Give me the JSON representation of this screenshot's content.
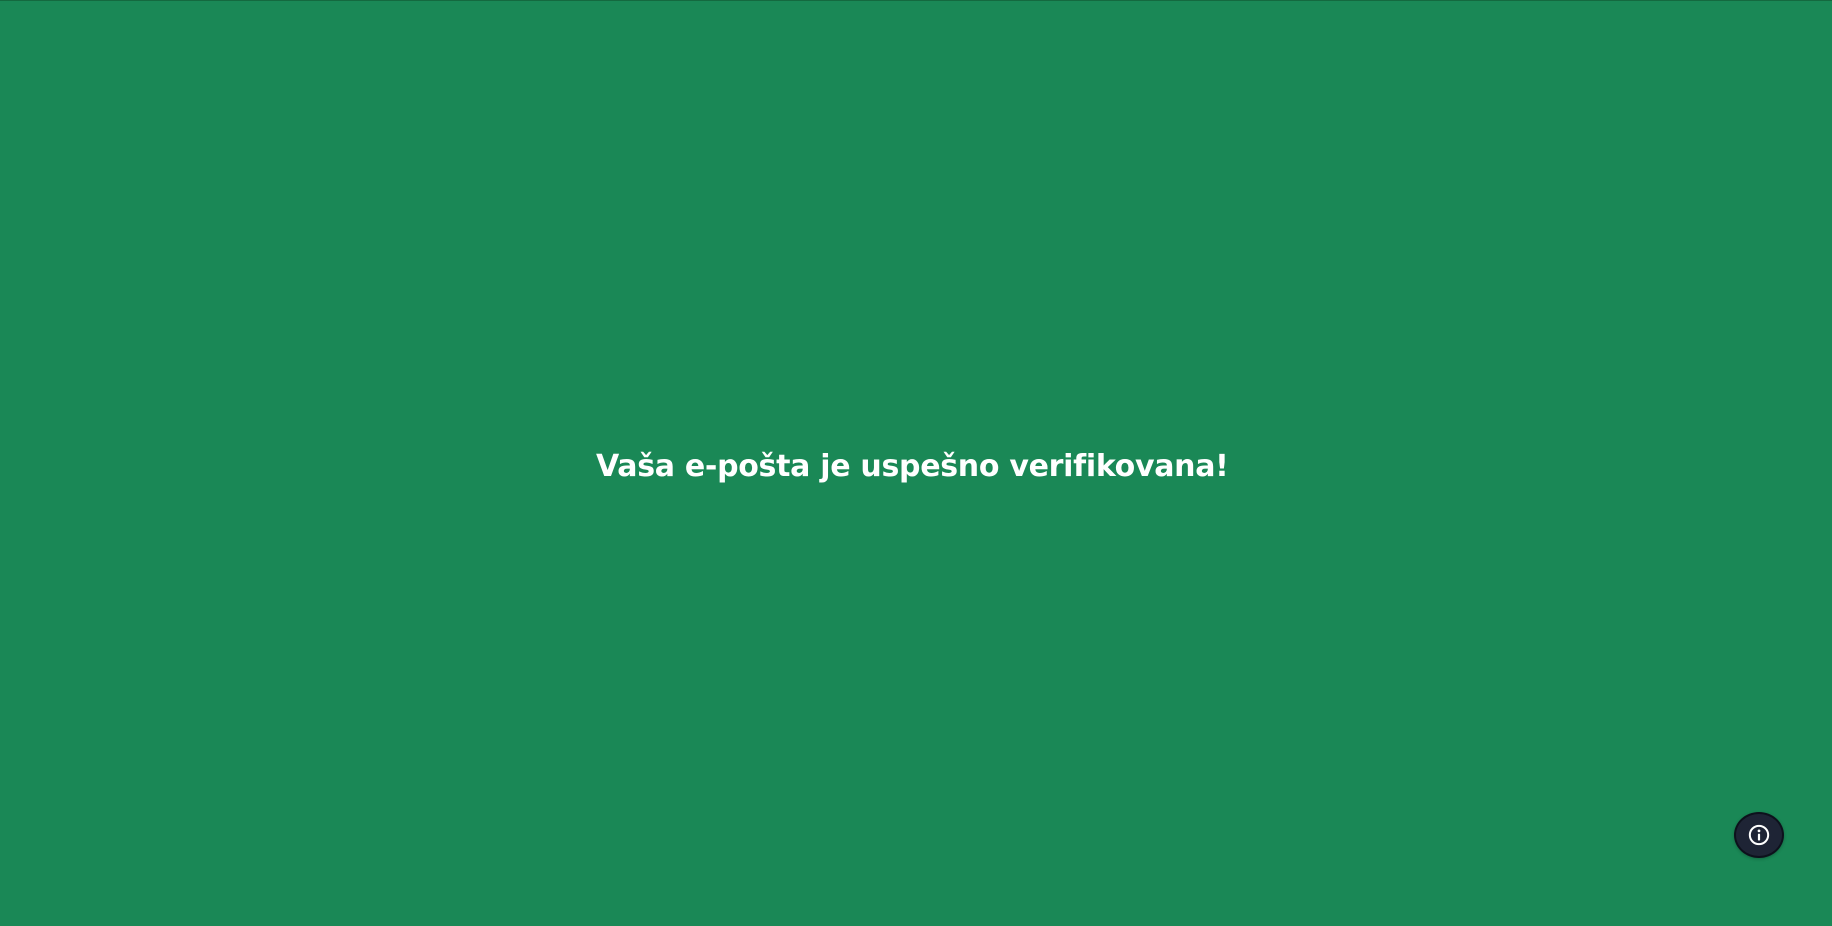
{
  "page": {
    "background_color": "#1a8856",
    "message": "Vaša e-pošta je uspešno verifikovana!"
  },
  "info_button": {
    "icon": "info-icon",
    "background_color": "#1e2435"
  }
}
